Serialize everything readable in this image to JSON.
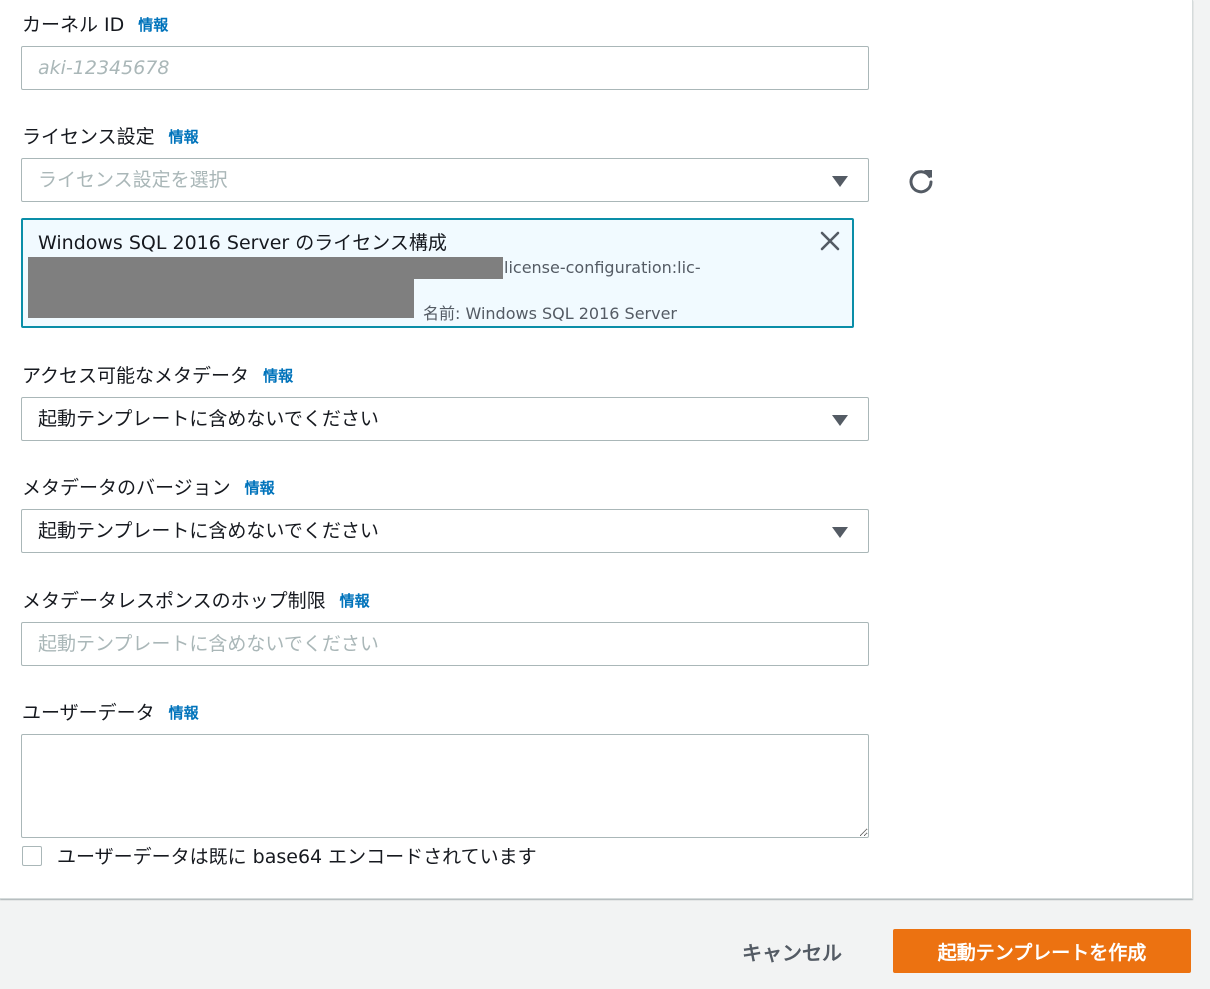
{
  "kernel": {
    "label": "カーネル ID",
    "info": "情報",
    "placeholder": "aki-12345678"
  },
  "license": {
    "label": "ライセンス設定",
    "info": "情報",
    "placeholder": "ライセンス設定を選択",
    "token": {
      "title": "Windows SQL 2016 Server のライセンス構成",
      "arn_suffix": "license-configuration:lic-",
      "name": "名前: Windows SQL 2016 Server"
    }
  },
  "metadata_access": {
    "label": "アクセス可能なメタデータ",
    "info": "情報",
    "value": "起動テンプレートに含めないでください"
  },
  "metadata_version": {
    "label": "メタデータのバージョン",
    "info": "情報",
    "value": "起動テンプレートに含めないでください"
  },
  "metadata_hop": {
    "label": "メタデータレスポンスのホップ制限",
    "info": "情報",
    "placeholder": "起動テンプレートに含めないでください"
  },
  "user_data": {
    "label": "ユーザーデータ",
    "info": "情報",
    "value": "",
    "base64_checkbox_label": "ユーザーデータは既に base64 エンコードされています"
  },
  "footer": {
    "cancel": "キャンセル",
    "create": "起動テンプレートを作成"
  },
  "colors": {
    "accent_link": "#0073bb",
    "primary_button": "#ec7211",
    "token_border": "#0a8ea8",
    "token_bg": "#f1faff"
  },
  "icons": {
    "refresh": "refresh-icon",
    "close": "close-icon",
    "caret": "caret-down-icon"
  }
}
